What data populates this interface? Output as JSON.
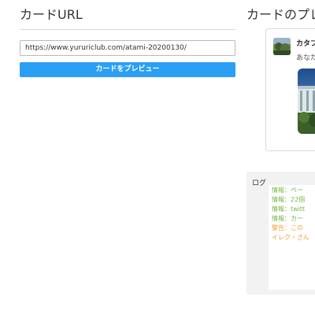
{
  "left": {
    "title": "カードURL",
    "url_value": "https://www.yururiclub.com/atami-20200130/",
    "preview_button_label": "カードをプレビュー"
  },
  "right": {
    "title": "カードのプレビュー",
    "card": {
      "name": "カタフ",
      "description": "あなた"
    }
  },
  "log": {
    "title": "ログ",
    "lines": [
      {
        "text": "情報：ペー",
        "color": "#7ab648"
      },
      {
        "text": "情報：22個",
        "color": "#7ab648"
      },
      {
        "text": "情報：twitt",
        "color": "#7ab648"
      },
      {
        "text": "情報：カー",
        "color": "#7ab648"
      },
      {
        "text": "警告：この",
        "color": "#f0a030"
      },
      {
        "text": "イレク・さん",
        "color": "#f0a030"
      }
    ]
  },
  "colors": {
    "accent": "#2a9ff3",
    "info": "#7ab648",
    "warning": "#f0a030"
  }
}
